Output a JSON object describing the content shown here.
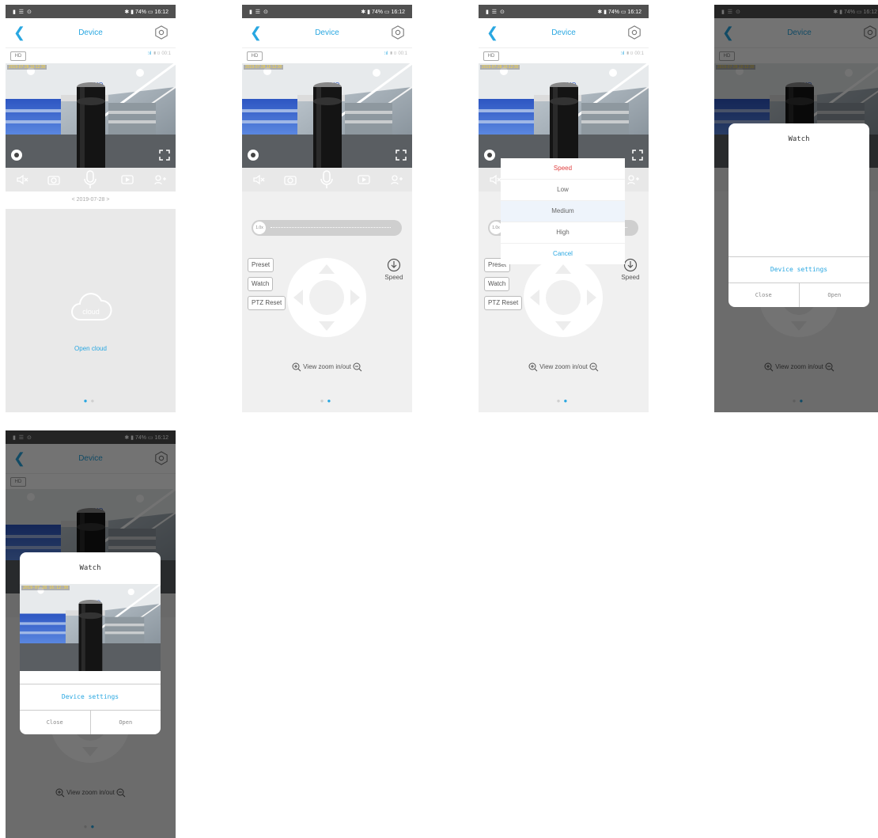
{
  "status_bar": {
    "left": "▮ ☰ ⊙",
    "right": "✱ ▮ 74% ▭ 16:12"
  },
  "header": {
    "title": "Device"
  },
  "info": {
    "hd_badge": "HD",
    "signal": "⫶ıl",
    "extra": "▮▯ 00:1"
  },
  "video": {
    "timestamp": "2019-07-28 16:12:30"
  },
  "date_nav": {
    "date": "<   2019-07-28   >"
  },
  "cloud": {
    "label": "cloud",
    "open": "Open cloud"
  },
  "ptz": {
    "slider_value": "1.0x",
    "preset": "Preset",
    "watch": "Watch",
    "reset": "PTZ Reset",
    "speed": "Speed",
    "zoom": "View zoom in/out"
  },
  "speed_dialog": {
    "title": "Speed",
    "options": [
      "Low",
      "Medium",
      "High"
    ],
    "selected": "Medium",
    "cancel": "Cancel"
  },
  "watch_dialog": {
    "title": "Watch",
    "settings": "Device settings",
    "close": "Close",
    "open": "Open"
  },
  "colors": {
    "accent": "#29a7e1",
    "speed_title": "#e04040"
  },
  "pager": {
    "count": 2
  }
}
